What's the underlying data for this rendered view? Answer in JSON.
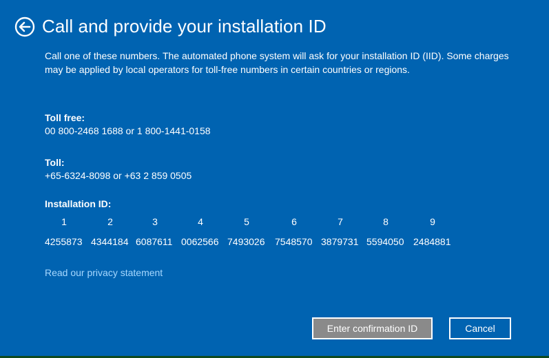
{
  "header": {
    "back_icon": "back-arrow-circle-icon",
    "title": "Call and provide your installation ID"
  },
  "description": "Call one of these numbers. The automated phone system will ask for your installation ID (IID). Some charges may be applied by local operators for toll-free numbers in certain countries or regions.",
  "toll_free": {
    "label": "Toll free:",
    "value": "00 800-2468 1688 or 1 800-1441-0158"
  },
  "toll": {
    "label": "Toll:",
    "value": "+65-6324-8098 or +63 2 859 0505"
  },
  "installation_id": {
    "label": "Installation ID:",
    "groups": [
      {
        "number": "1",
        "value": "4255873"
      },
      {
        "number": "2",
        "value": "4344184"
      },
      {
        "number": "3",
        "value": "6087611"
      },
      {
        "number": "4",
        "value": "0062566"
      },
      {
        "number": "5",
        "value": "7493026"
      },
      {
        "number": "6",
        "value": "7548570"
      },
      {
        "number": "7",
        "value": "3879731"
      },
      {
        "number": "8",
        "value": "5594050"
      },
      {
        "number": "9",
        "value": "2484881"
      }
    ]
  },
  "privacy_link": "Read our privacy statement",
  "buttons": {
    "enter_confirmation": "Enter confirmation ID",
    "cancel": "Cancel"
  },
  "colors": {
    "background": "#0063b1",
    "link": "#a6d8ff",
    "primary_button": "#8a8a8a",
    "taskbar_strip": "#0f4a1f"
  }
}
